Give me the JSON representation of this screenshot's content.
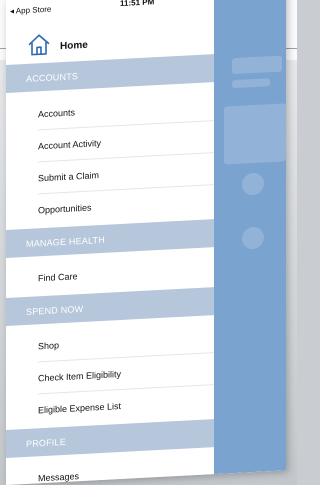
{
  "status": {
    "carrier": "◂ App Store",
    "time": "11:51 PM",
    "icons": "◀ ▮▮ ▬"
  },
  "drawer": {
    "home_label": "Home",
    "sections": [
      {
        "title": "ACCOUNTS",
        "items": [
          "Accounts",
          "Account Activity",
          "Submit a Claim",
          "Opportunities"
        ]
      },
      {
        "title": "MANAGE HEALTH",
        "items": [
          "Find Care"
        ]
      },
      {
        "title": "SPEND NOW",
        "items": [
          "Shop",
          "Check Item Eligibility",
          "Eligible Expense List"
        ]
      },
      {
        "title": "PROFILE",
        "items": [
          "Messages"
        ]
      }
    ]
  },
  "colors": {
    "section_bg": "#b6c6db",
    "accent": "#2a69b0",
    "backpanel": "#7aa3cf"
  }
}
